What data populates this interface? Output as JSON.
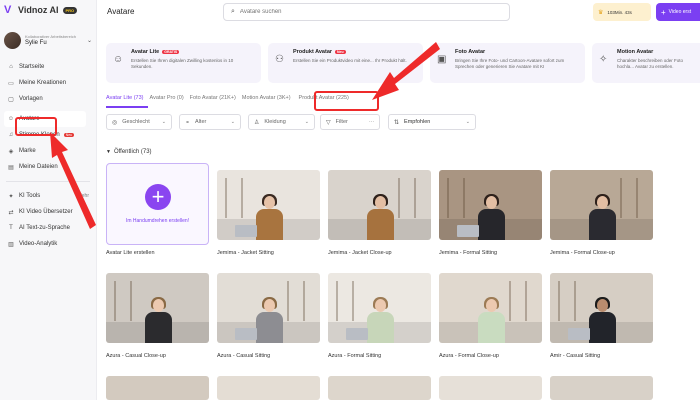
{
  "app": {
    "logo_text": "Vidnoz AI",
    "pro_badge": "PRO"
  },
  "user": {
    "workspace": "Kollaborativer Arbeitsbereich",
    "name": "Sylie Fu"
  },
  "sidebar": {
    "items": [
      {
        "label": "Startseite",
        "icon": "home-icon"
      },
      {
        "label": "Meine Kreationen",
        "icon": "folder-icon"
      },
      {
        "label": "Vorlagen",
        "icon": "template-icon"
      },
      {
        "label": "Avatare",
        "icon": "avatar-icon",
        "active": true
      },
      {
        "label": "Stimme Klonen",
        "icon": "voice-icon",
        "badge": "Neu"
      },
      {
        "label": "Marke",
        "icon": "brand-icon"
      },
      {
        "label": "Meine Dateien",
        "icon": "files-icon"
      }
    ],
    "tools_header": {
      "label": "KI Tools",
      "more": "Mehr"
    },
    "tools": [
      {
        "label": "KI Video Übersetzer",
        "icon": "translate-icon"
      },
      {
        "label": "AI Text-zu-Sprache",
        "icon": "tts-icon"
      },
      {
        "label": "Video-Analytik",
        "icon": "analytics-icon"
      }
    ]
  },
  "header": {
    "title": "Avatare",
    "search_placeholder": "Avatare suchen",
    "credits": "103Min. 43s",
    "create_label": "Video erst"
  },
  "cards": [
    {
      "title": "Avatar Lite",
      "badge": "GRATIS",
      "desc": "Erstellen Sie Ihren digitalen Zwilling kostenlos in 10 Sekunden.",
      "icon": "avatar-lite-icon"
    },
    {
      "title": "Produkt Avatar",
      "badge": "Neu",
      "desc": "Erstellen Sie ein Produktvideo mit eine... Ihr Produkt hält.",
      "icon": "product-avatar-icon"
    },
    {
      "title": "Foto Avatar",
      "badge": "",
      "desc": "Bringen Sie Ihre Foto- und Cartoon-Avatare sofort zum Sprechen oder generieren Sie Avatare mit KI",
      "icon": "photo-avatar-icon"
    },
    {
      "title": "Motion Avatar",
      "badge": "",
      "desc": "Charakter beschreiben oder Foto hochla... Avatar zu erstellen.",
      "icon": "motion-avatar-icon"
    }
  ],
  "tabs": [
    {
      "label": "Avatar Lite (73)",
      "active": true
    },
    {
      "label": "Avatar Pro (0)"
    },
    {
      "label": "Foto Avatar (21K+)"
    },
    {
      "label": "Motion Avatar (3K+)"
    },
    {
      "label": "Produkt Avatar (225)"
    }
  ],
  "filters": {
    "gender": "Geschlecht",
    "age": "Alter",
    "clothing": "Kleidung",
    "filter": "Filter",
    "more": "···",
    "sort": "Empfohlen"
  },
  "section": {
    "title": "Öffentlich (73)"
  },
  "create_card": {
    "label": "Im Handumdrehen erstellen!",
    "caption": "Avatar Lite erstellen"
  },
  "avatars": [
    {
      "name": "Jemima - Jacket Sitting",
      "bg": "#e9e4de",
      "hair": "#3a2a22",
      "skin": "#e6c2a8",
      "body": "#a8743f"
    },
    {
      "name": "Jemima - Jacket Close-up",
      "bg": "#d9d3cc",
      "hair": "#2e211b",
      "skin": "#e3bea3",
      "body": "#a6723e"
    },
    {
      "name": "Jemima - Formal Sitting",
      "bg": "#a99582",
      "hair": "#2e211b",
      "skin": "#e3bea3",
      "body": "#26262b"
    },
    {
      "name": "Jemima - Formal Close-up",
      "bg": "#b8a896",
      "hair": "#2e211b",
      "skin": "#e3bea3",
      "body": "#2a2a30"
    },
    {
      "name": "Azura - Casual Close-up",
      "bg": "#cfc9c2",
      "hair": "#8a6a45",
      "skin": "#ecc9b0",
      "body": "#2b2b2e"
    },
    {
      "name": "Azura - Casual Sitting",
      "bg": "#e2ddd6",
      "hair": "#8a6a45",
      "skin": "#ecc9b0",
      "body": "#8d8d92"
    },
    {
      "name": "Azura - Formal Sitting",
      "bg": "#ece8e2",
      "hair": "#9c7b55",
      "skin": "#ecc9b0",
      "body": "#c7d6b9"
    },
    {
      "name": "Azura - Formal Close-up",
      "bg": "#e0d8ce",
      "hair": "#9c7b55",
      "skin": "#ecc9b0",
      "body": "#c9dcc0"
    },
    {
      "name": "Amir - Casual Sitting",
      "bg": "#d6cec4",
      "hair": "#1c1c1c",
      "skin": "#b98c6e",
      "body": "#22242a"
    }
  ],
  "colors": {
    "accent": "#7b3ff2",
    "annotation": "#ee2a2a"
  }
}
